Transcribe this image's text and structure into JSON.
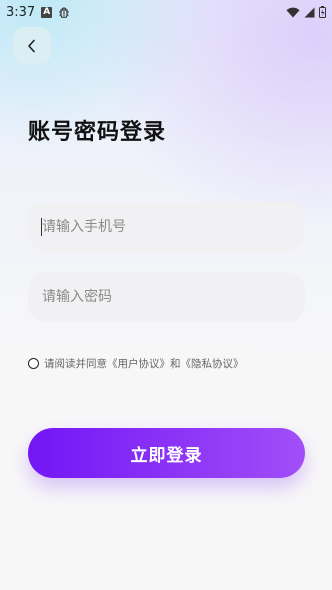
{
  "status_bar": {
    "time": "3:37",
    "notification_letter": "A"
  },
  "page": {
    "title": "账号密码登录"
  },
  "form": {
    "phone_placeholder": "请输入手机号",
    "password_placeholder": "请输入密码",
    "agreement_text": "请阅读并同意《用户协议》和《隐私协议》",
    "login_label": "立即登录"
  },
  "colors": {
    "accent_start": "#7216f5",
    "accent_end": "#a24ef8"
  }
}
